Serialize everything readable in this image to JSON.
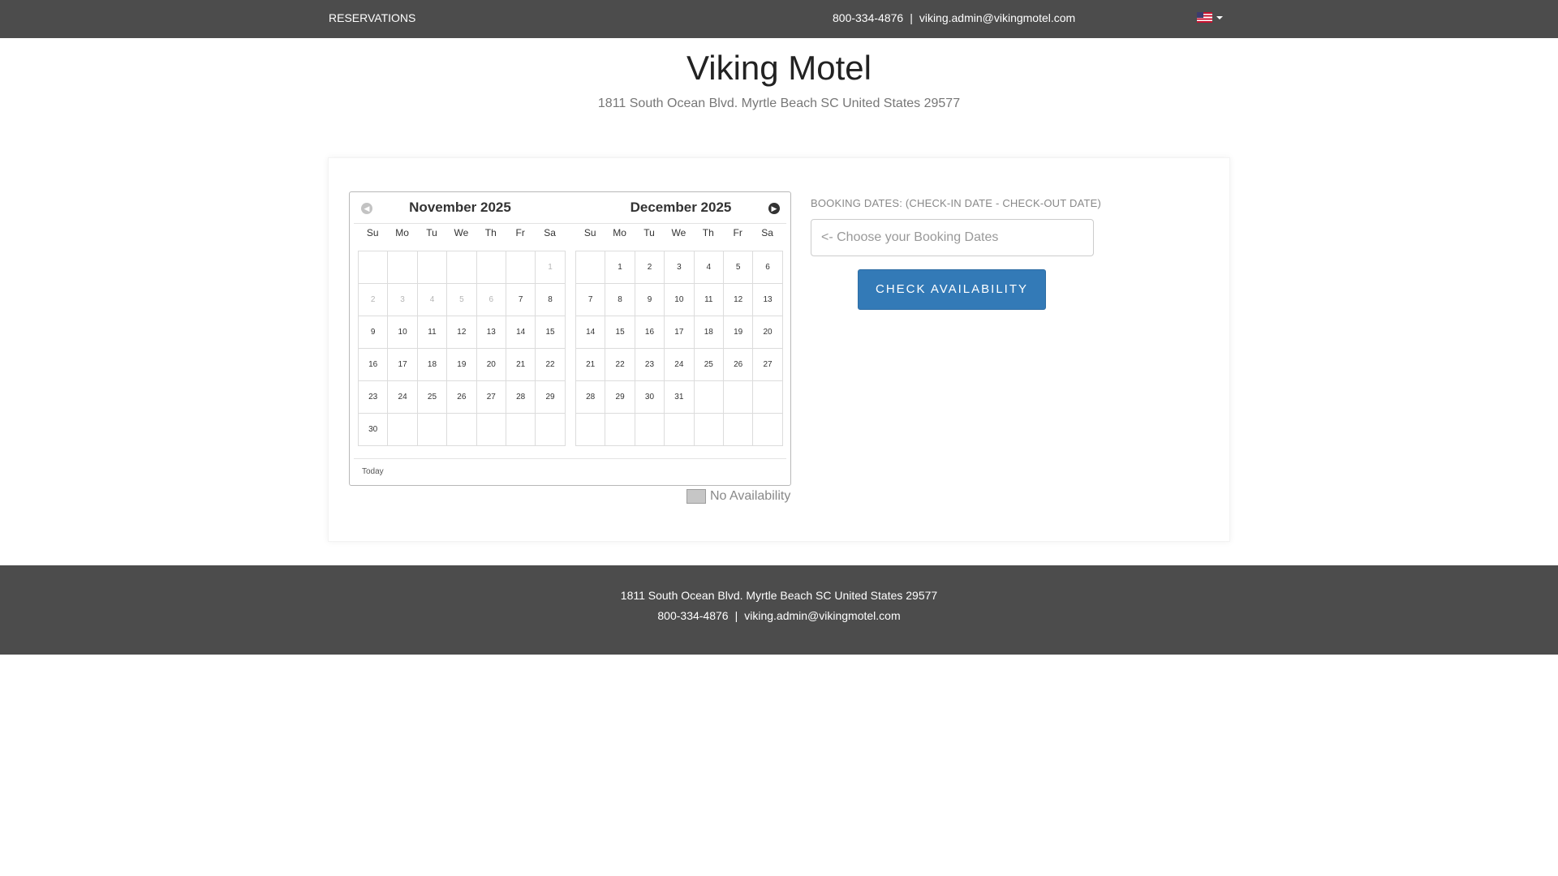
{
  "topbar": {
    "brand": "RESERVATIONS",
    "phone": "800-334-4876",
    "separator": "|",
    "email": "viking.admin@vikingmotel.com",
    "language_icon": "us-flag-icon"
  },
  "header": {
    "title": "Viking Motel",
    "address": "1811 South Ocean Blvd. Myrtle Beach SC United States 29577"
  },
  "calendar": {
    "prev_icon": "chevron-left-icon",
    "next_icon": "chevron-right-icon",
    "prev_glyph": "◀",
    "next_glyph": "▶",
    "weekdays": [
      "Su",
      "Mo",
      "Tu",
      "We",
      "Th",
      "Fr",
      "Sa"
    ],
    "months": [
      {
        "title": "November 2025",
        "first_weekday": 6,
        "days_in_month": 30,
        "disabled_through": 6,
        "rows": 6
      },
      {
        "title": "December 2025",
        "first_weekday": 1,
        "days_in_month": 31,
        "disabled_through": 0,
        "rows": 6
      }
    ],
    "today_label": "Today"
  },
  "legend": {
    "no_availability": "No Availability",
    "swatch_color": "#c6c6c6"
  },
  "booking": {
    "label": "BOOKING DATES: (CHECK-IN DATE - CHECK-OUT DATE)",
    "placeholder": "<- Choose your Booking Dates",
    "value": "",
    "button_label": "CHECK AVAILABILITY",
    "accent_color": "#337ab7"
  },
  "footer": {
    "address": "1811 South Ocean Blvd. Myrtle Beach SC United States 29577",
    "phone": "800-334-4876",
    "separator": "|",
    "email": "viking.admin@vikingmotel.com"
  }
}
